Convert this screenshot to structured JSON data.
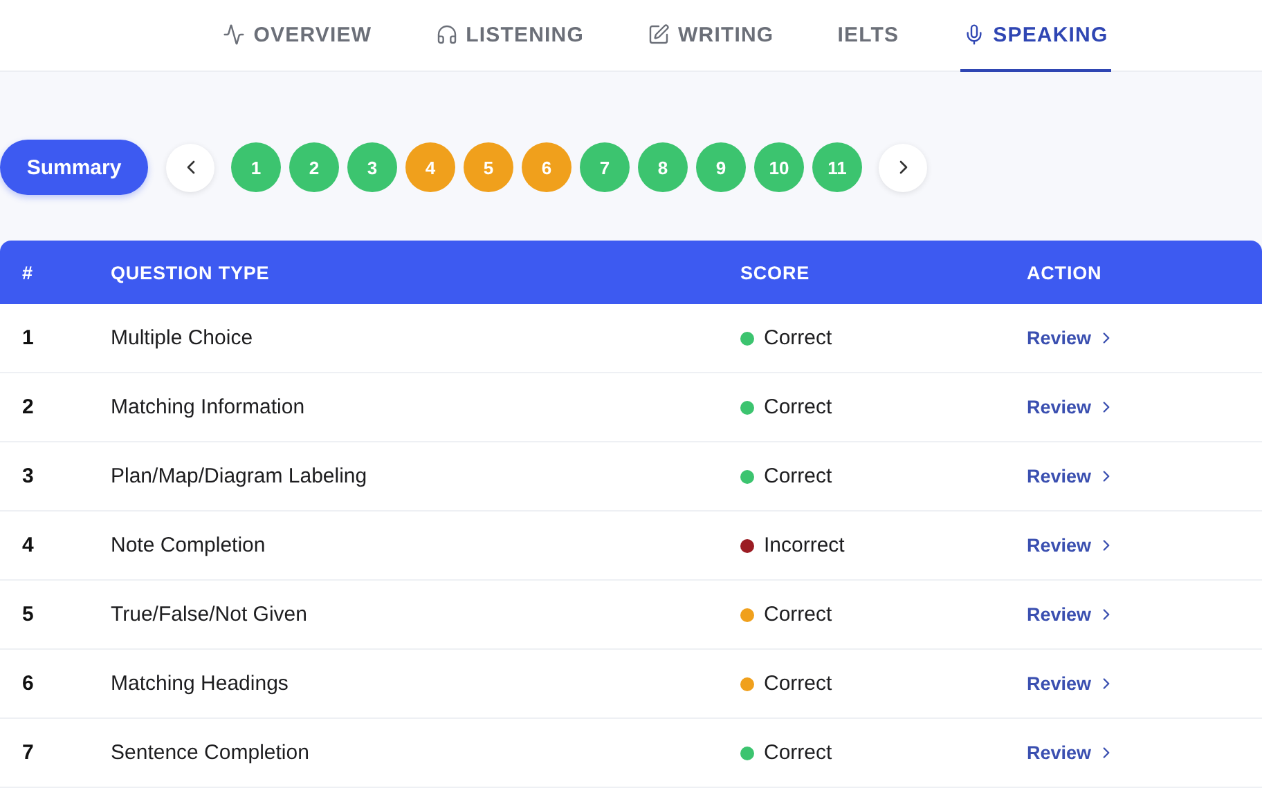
{
  "tabs": [
    {
      "label": "OVERVIEW",
      "selected": false
    },
    {
      "label": "LISTENING",
      "selected": false
    },
    {
      "label": "WRITING",
      "selected": false
    },
    {
      "label": "IELTS",
      "selected": false
    },
    {
      "label": "SPEAKING",
      "selected": true
    }
  ],
  "summary_button": "Summary",
  "questions": [
    {
      "label": "1",
      "color": "#3cc46f"
    },
    {
      "label": "2",
      "color": "#3cc46f"
    },
    {
      "label": "3",
      "color": "#3cc46f"
    },
    {
      "label": "4",
      "color": "#f0a01c"
    },
    {
      "label": "5",
      "color": "#f0a01c"
    },
    {
      "label": "6",
      "color": "#f0a01c"
    },
    {
      "label": "7",
      "color": "#3cc46f"
    },
    {
      "label": "8",
      "color": "#3cc46f"
    },
    {
      "label": "9",
      "color": "#3cc46f"
    },
    {
      "label": "10",
      "color": "#3cc46f"
    },
    {
      "label": "11",
      "color": "#3cc46f"
    }
  ],
  "table": {
    "columns": [
      "#",
      "QUESTION TYPE",
      "SCORE",
      "ACTION"
    ],
    "rows": [
      {
        "number": "1",
        "type": "Multiple Choice",
        "score": "Correct",
        "color": "#3cc46f",
        "action": "Review"
      },
      {
        "number": "2",
        "type": "Matching Information",
        "score": "Correct",
        "color": "#3cc46f",
        "action": "Review"
      },
      {
        "number": "3",
        "type": "Plan/Map/Diagram Labeling",
        "score": "Correct",
        "color": "#3cc46f",
        "action": "Review"
      },
      {
        "number": "4",
        "type": "Note Completion",
        "score": "Incorrect",
        "color": "#9b1c23",
        "action": "Review"
      },
      {
        "number": "5",
        "type": "True/False/Not Given",
        "score": "Correct",
        "color": "#f0a01c",
        "action": "Review"
      },
      {
        "number": "6",
        "type": "Matching Headings",
        "score": "Correct",
        "color": "#f0a01c",
        "action": "Review"
      },
      {
        "number": "7",
        "type": "Sentence Completion",
        "score": "Correct",
        "color": "#3cc46f",
        "action": "Review"
      }
    ]
  }
}
